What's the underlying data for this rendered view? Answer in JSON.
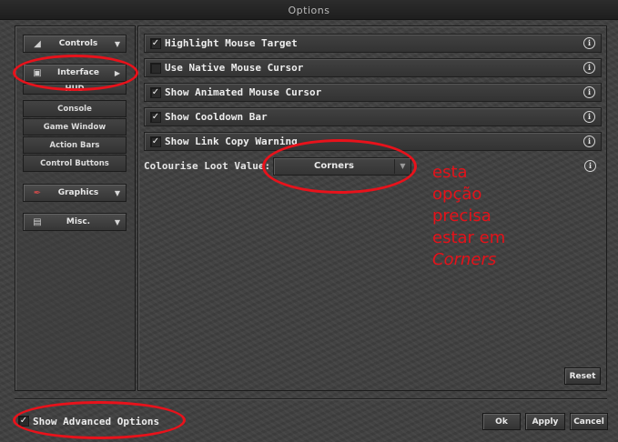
{
  "window": {
    "title": "Options"
  },
  "sidebar": {
    "categories": [
      {
        "label": "Controls",
        "icon": "controls-icon"
      },
      {
        "label": "Interface",
        "icon": "interface-icon"
      },
      {
        "label": "Graphics",
        "icon": "brush-icon"
      },
      {
        "label": "Misc.",
        "icon": "scroll-icon"
      }
    ],
    "interface_items": [
      "HUD",
      "Console",
      "Game Window",
      "Action Bars",
      "Control Buttons"
    ]
  },
  "options": [
    {
      "label": "Highlight Mouse Target",
      "checked": true
    },
    {
      "label": "Use Native Mouse Cursor",
      "checked": false
    },
    {
      "label": "Show Animated Mouse Cursor",
      "checked": true
    },
    {
      "label": "Show Cooldown Bar",
      "checked": true
    },
    {
      "label": "Show Link Copy Warning",
      "checked": true
    }
  ],
  "loot": {
    "label": "Colourise Loot Value:",
    "selected": "Corners"
  },
  "buttons": {
    "reset": "Reset",
    "ok": "Ok",
    "apply": "Apply",
    "cancel": "Cancel"
  },
  "advanced": {
    "label": "Show Advanced Options",
    "checked": true
  },
  "annotation": {
    "lines": [
      "esta",
      "opção",
      "precisa",
      "estar em"
    ],
    "emphasis": "Corners",
    "color": "#e4121a"
  },
  "colors": {
    "accent": "#e8121b",
    "panel": "#404040"
  }
}
